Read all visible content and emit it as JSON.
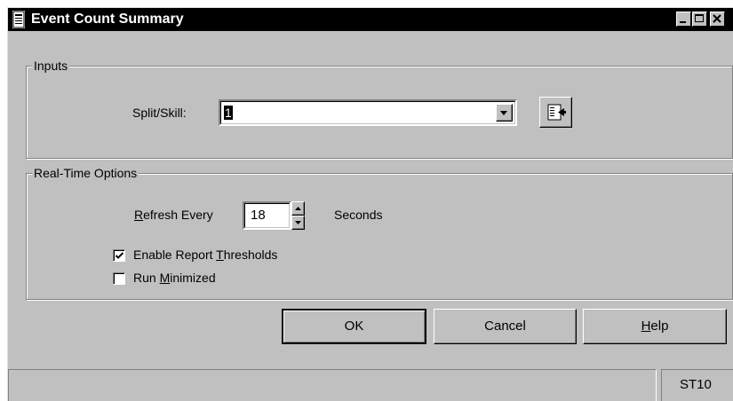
{
  "window": {
    "title": "Event Count Summary",
    "icon": "report-icon",
    "caption_buttons": [
      "minimize-icon",
      "maximize-icon",
      "close-icon"
    ]
  },
  "inputs": {
    "group_label": "Inputs",
    "split_skill_label": "Split/Skill:",
    "split_skill_value": "1",
    "browse_icon": "browse-list-icon"
  },
  "realtime": {
    "group_label": "Real-Time Options",
    "refresh_prefix": "R",
    "refresh_rest": "efresh Every",
    "refresh_value": "18",
    "seconds_label": "Seconds",
    "thresholds_pre": "Enable Report ",
    "thresholds_key": "T",
    "thresholds_post": "hresholds",
    "thresholds_checked": true,
    "minimized_pre": "Run ",
    "minimized_key": "M",
    "minimized_post": "inimized",
    "minimized_checked": false
  },
  "buttons": {
    "ok": "OK",
    "cancel": "Cancel",
    "help_key": "H",
    "help_rest": "elp"
  },
  "status": {
    "code": "ST10"
  }
}
